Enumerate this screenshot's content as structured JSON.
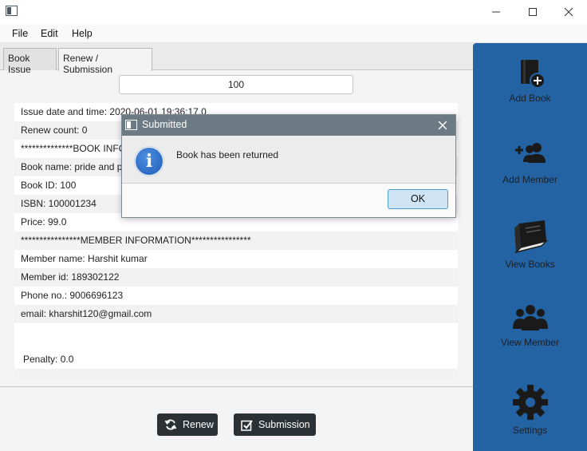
{
  "menu": {
    "items": [
      "File",
      "Edit",
      "Help"
    ]
  },
  "tabs": [
    {
      "label": "Book Issue",
      "active": false
    },
    {
      "label": "Renew / Submission",
      "active": true
    }
  ],
  "search": {
    "value": "100"
  },
  "info": {
    "rows": [
      "Issue date and time: 2020-06-01 19:36:17.0",
      "Renew count: 0",
      "**************BOOK INFORMATION**************",
      "Book name: pride and prejudice",
      "Book ID: 100",
      "ISBN: 100001234",
      "Price: 99.0",
      "****************MEMBER INFORMATION****************",
      "Member name: Harshit kumar",
      "Member id: 189302122",
      "Phone no.:  9006696123",
      "email: kharshit120@gmail.com"
    ],
    "penalty": "Penalty: 0.0"
  },
  "actions": {
    "renew_label": "Renew",
    "submission_label": "Submission"
  },
  "sidebar": {
    "items": [
      {
        "label": "Add Book",
        "icon": "add-book-icon"
      },
      {
        "label": "Add Member",
        "icon": "add-member-icon"
      },
      {
        "label": "View Books",
        "icon": "view-books-icon"
      },
      {
        "label": "View Member",
        "icon": "view-member-icon"
      },
      {
        "label": "Settings",
        "icon": "gear-icon"
      }
    ]
  },
  "dialog": {
    "title": "Submitted",
    "message": "Book has been returned",
    "ok_label": "OK"
  },
  "colors": {
    "sidebar": "#2363a4",
    "dialog_title": "#6c7b83",
    "button_dark": "#2b3135"
  }
}
